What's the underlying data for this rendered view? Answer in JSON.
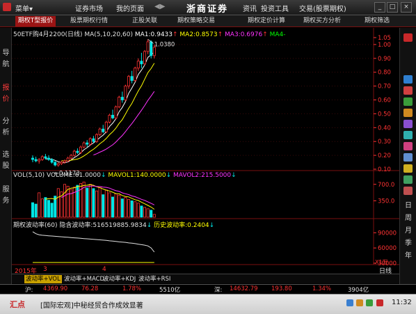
{
  "titlebar": {
    "menu_label": "菜单",
    "menu_arrow": "▾",
    "items": [
      "证券市场",
      "我的页面"
    ],
    "brand": "浙商证券",
    "right_items": [
      "资讯",
      "投资工具",
      "交易(股票期权)"
    ],
    "win_minimize": "_",
    "win_maximize": "□",
    "win_close": "×"
  },
  "tabs": [
    "期权T型报价",
    "股票期权行情",
    "正股关联",
    "期权策略交易",
    "期权定价计算",
    "期权买方分析",
    "期权筛选"
  ],
  "leftbar": [
    "导",
    "航",
    "报",
    "价",
    "分",
    "析",
    "选",
    "股",
    "服",
    "务"
  ],
  "rightbar": {
    "chars": [
      "日",
      "周",
      "月",
      "季",
      "年"
    ]
  },
  "price_panel": {
    "title": "50ETF购4月2200(日线)",
    "ma_label": "MA(5,10,20,60)",
    "ma1": "MA1:0.9433",
    "ma2": "MA2:0.8573",
    "ma3": "MA3:0.6976",
    "ma4": "MA4-",
    "high_label": "1.0380",
    "low_label": "0.1173",
    "yaxis": [
      "1.05",
      "1.00",
      "0.90",
      "0.80",
      "0.70",
      "0.60",
      "0.50",
      "0.40",
      "0.30",
      "0.20",
      "0.10"
    ]
  },
  "vol_panel": {
    "title": "VOL(5,10)",
    "volume": "VOLUME:61.0000",
    "mavol1": "MAVOL1:140.0000",
    "mavol2": "MAVOL2:215.5000",
    "yaxis": [
      "700.0",
      "350.0"
    ]
  },
  "iv_panel": {
    "title": "期权波动率(60)",
    "implied": "隐含波动率:516519885.9834",
    "historical": "历史波动率:0.2404",
    "yaxis": [
      "90000",
      "60000",
      "30000"
    ],
    "unit": "X1万"
  },
  "date_axis": {
    "year": "2015年",
    "m1": "3",
    "m2": "4",
    "period": "日线"
  },
  "functabs": [
    "波动率+VOL",
    "波动率+MACD",
    "波动率+KDJ",
    "波动率+RSI"
  ],
  "statusbar": {
    "sh_label": "沪:",
    "sh_index": "4369.90",
    "sh_change": "76.28",
    "sh_pct": "1.78%",
    "sh_amount": "5510亿",
    "sz_label": "深:",
    "sz_index": "14632.79",
    "sz_change": "193.80",
    "sz_pct": "1.34%",
    "sz_amount": "3904亿"
  },
  "newsbar": {
    "logo": "汇点",
    "headline": "[国际宏观]中秘经贸合作成效显著",
    "time": "11:32"
  },
  "colors": {
    "up": "#ff3333",
    "down": "#00e5e5",
    "ma1": "#ffffff",
    "ma2": "#ffff00",
    "ma3": "#ff33ff",
    "ma4": "#00ff00",
    "accent": "#9b1414"
  },
  "chart_data": {
    "type": "candlestick",
    "candles": [
      {
        "o": 0.18,
        "h": 0.2,
        "l": 0.15,
        "c": 0.17
      },
      {
        "o": 0.17,
        "h": 0.19,
        "l": 0.15,
        "c": 0.16
      },
      {
        "o": 0.16,
        "h": 0.18,
        "l": 0.14,
        "c": 0.17
      },
      {
        "o": 0.17,
        "h": 0.2,
        "l": 0.16,
        "c": 0.19
      },
      {
        "o": 0.19,
        "h": 0.21,
        "l": 0.17,
        "c": 0.18
      },
      {
        "o": 0.18,
        "h": 0.2,
        "l": 0.16,
        "c": 0.17
      },
      {
        "o": 0.17,
        "h": 0.18,
        "l": 0.14,
        "c": 0.15
      },
      {
        "o": 0.15,
        "h": 0.16,
        "l": 0.12,
        "c": 0.13
      },
      {
        "o": 0.13,
        "h": 0.15,
        "l": 0.1173,
        "c": 0.14
      },
      {
        "o": 0.14,
        "h": 0.16,
        "l": 0.13,
        "c": 0.15
      },
      {
        "o": 0.15,
        "h": 0.17,
        "l": 0.14,
        "c": 0.16
      },
      {
        "o": 0.16,
        "h": 0.19,
        "l": 0.15,
        "c": 0.18
      },
      {
        "o": 0.18,
        "h": 0.21,
        "l": 0.17,
        "c": 0.2
      },
      {
        "o": 0.2,
        "h": 0.24,
        "l": 0.19,
        "c": 0.23
      },
      {
        "o": 0.23,
        "h": 0.25,
        "l": 0.21,
        "c": 0.22
      },
      {
        "o": 0.22,
        "h": 0.27,
        "l": 0.21,
        "c": 0.26
      },
      {
        "o": 0.26,
        "h": 0.3,
        "l": 0.25,
        "c": 0.29
      },
      {
        "o": 0.29,
        "h": 0.31,
        "l": 0.26,
        "c": 0.28
      },
      {
        "o": 0.28,
        "h": 0.33,
        "l": 0.27,
        "c": 0.32
      },
      {
        "o": 0.32,
        "h": 0.34,
        "l": 0.29,
        "c": 0.3
      },
      {
        "o": 0.3,
        "h": 0.36,
        "l": 0.29,
        "c": 0.35
      },
      {
        "o": 0.35,
        "h": 0.4,
        "l": 0.34,
        "c": 0.39
      },
      {
        "o": 0.39,
        "h": 0.42,
        "l": 0.36,
        "c": 0.37
      },
      {
        "o": 0.37,
        "h": 0.45,
        "l": 0.36,
        "c": 0.44
      },
      {
        "o": 0.44,
        "h": 0.5,
        "l": 0.43,
        "c": 0.49
      },
      {
        "o": 0.49,
        "h": 0.53,
        "l": 0.46,
        "c": 0.47
      },
      {
        "o": 0.47,
        "h": 0.56,
        "l": 0.46,
        "c": 0.55
      },
      {
        "o": 0.55,
        "h": 0.63,
        "l": 0.54,
        "c": 0.62
      },
      {
        "o": 0.62,
        "h": 0.66,
        "l": 0.58,
        "c": 0.6
      },
      {
        "o": 0.6,
        "h": 0.71,
        "l": 0.59,
        "c": 0.7
      },
      {
        "o": 0.7,
        "h": 0.78,
        "l": 0.68,
        "c": 0.77
      },
      {
        "o": 0.77,
        "h": 0.81,
        "l": 0.72,
        "c": 0.74
      },
      {
        "o": 0.74,
        "h": 0.84,
        "l": 0.73,
        "c": 0.83
      },
      {
        "o": 0.83,
        "h": 0.9,
        "l": 0.81,
        "c": 0.88
      },
      {
        "o": 0.88,
        "h": 0.94,
        "l": 0.83,
        "c": 0.86
      },
      {
        "o": 0.86,
        "h": 0.96,
        "l": 0.85,
        "c": 0.95
      },
      {
        "o": 0.95,
        "h": 1.038,
        "l": 0.93,
        "c": 1.02
      },
      {
        "o": 1.02,
        "h": 1.03,
        "l": 0.9,
        "c": 0.92
      },
      {
        "o": 0.92,
        "h": 1.0,
        "l": 0.9,
        "c": 0.98
      }
    ],
    "volume": [
      310,
      280,
      520,
      390,
      420,
      360,
      300,
      450,
      610,
      540,
      700,
      660,
      590,
      640,
      680,
      720,
      750,
      620,
      700,
      610,
      560,
      650,
      480,
      580,
      520,
      430,
      500,
      470,
      390,
      420,
      380,
      350,
      330,
      300,
      240,
      210,
      180,
      150,
      61
    ],
    "implied_vol": [
      92000,
      88000,
      86000,
      85000,
      84500,
      84000,
      83500,
      83000,
      82500,
      82000,
      81500,
      81000,
      80500,
      80000,
      79500,
      79000,
      78500,
      78000,
      77500,
      77000,
      76500,
      76000,
      75500,
      75000,
      74000,
      73500,
      73000,
      72000,
      71500,
      71000,
      70000,
      69500,
      68500,
      67500,
      66500,
      65500,
      64000,
      60000,
      52000
    ],
    "ylim_price": [
      0.1,
      1.05
    ],
    "ylim_vol": [
      0,
      800
    ],
    "ylim_iv": [
      30000,
      100000
    ]
  }
}
